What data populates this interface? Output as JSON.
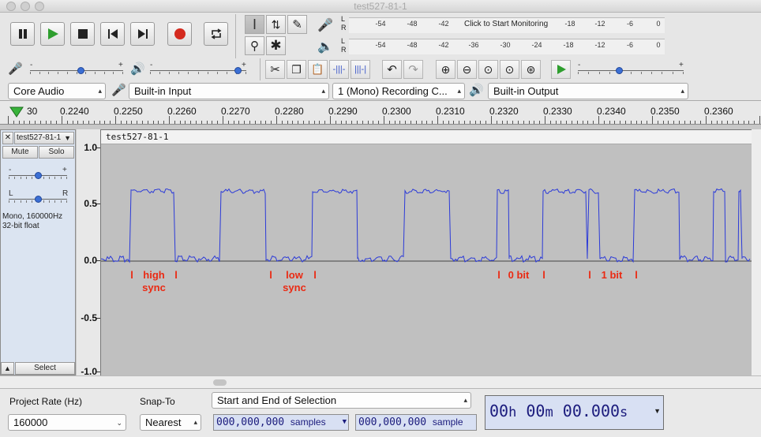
{
  "window": {
    "title": "test527-81-1"
  },
  "transport": {
    "pause": "pause-icon",
    "play": "play-icon",
    "stop": "stop-icon",
    "skip_start": "skip-to-start-icon",
    "skip_end": "skip-to-end-icon",
    "record": "record-icon",
    "loop": "loop-icon",
    "colors": {
      "play": "#2e9e2e",
      "record": "#d42a1e"
    }
  },
  "meters": {
    "record_ticks": [
      "-54",
      "-48",
      "-42",
      "-18",
      "-12",
      "-6",
      "0"
    ],
    "record_monitor_text": "Click to Start Monitoring",
    "playback_ticks": [
      "-54",
      "-48",
      "-42",
      "-36",
      "-30",
      "-24",
      "-18",
      "-12",
      "-6",
      "0"
    ],
    "lr": [
      "L",
      "R"
    ]
  },
  "sliders": {
    "recording_volume": 0.55,
    "playback_volume": 0.95,
    "play_at_speed": 0.38,
    "plus": "+",
    "minus": "-"
  },
  "devices": {
    "host": "Core Audio",
    "input": "Built-in Input",
    "channels": "1 (Mono) Recording C...",
    "output": "Built-in Output"
  },
  "ruler": {
    "labels": [
      "30",
      "0.2240",
      "0.2250",
      "0.2260",
      "0.2270",
      "0.2280",
      "0.2290",
      "0.2300",
      "0.2310",
      "0.2320",
      "0.2330",
      "0.2340",
      "0.2350",
      "0.2360"
    ]
  },
  "track": {
    "name": "test527-81-1",
    "clip_name": "test527-81-1",
    "mute_label": "Mute",
    "solo_label": "Solo",
    "gain_marks": [
      "-",
      "+"
    ],
    "pan_marks": [
      "L",
      "R"
    ],
    "info_line1": "Mono, 160000Hz",
    "info_line2": "32-bit float",
    "select_label": "Select",
    "collapse_icon": "collapse-arrow-icon",
    "close_icon": "close-icon"
  },
  "amplitude_axis": {
    "labels": [
      "1.0",
      "0.5",
      "0.0",
      "-0.5",
      "-1.0"
    ]
  },
  "annotations": [
    {
      "mark": "l",
      "text": ""
    },
    {
      "mark": "",
      "text": "high\nsync"
    },
    {
      "mark": "l",
      "text": ""
    },
    {
      "mark": "l",
      "text": ""
    },
    {
      "mark": "",
      "text": "low\nsync"
    },
    {
      "mark": "l",
      "text": ""
    },
    {
      "mark": "l",
      "text": ""
    },
    {
      "mark": "",
      "text": "0 bit"
    },
    {
      "mark": "l",
      "text": ""
    },
    {
      "mark": "l",
      "text": ""
    },
    {
      "mark": "",
      "text": "1 bit"
    },
    {
      "mark": "l",
      "text": ""
    }
  ],
  "waveform": {
    "color": "#2b3ad8",
    "background": "#c0c0c0",
    "high_level": 0.62,
    "low_level": 0.02
  },
  "selection_bar": {
    "project_rate_label": "Project Rate (Hz)",
    "project_rate_value": "160000",
    "snap_to_label": "Snap-To",
    "snap_to_value": "Nearest",
    "selection_mode": "Start and End of Selection",
    "start_digits": "000,000,000",
    "end_digits": "000,000,000",
    "unit": "samples",
    "unit_truncated": "sample",
    "time_display": [
      "00",
      "h",
      "00",
      "m",
      "00.000",
      "s"
    ]
  },
  "scrollbar": {
    "position": 0.28
  }
}
